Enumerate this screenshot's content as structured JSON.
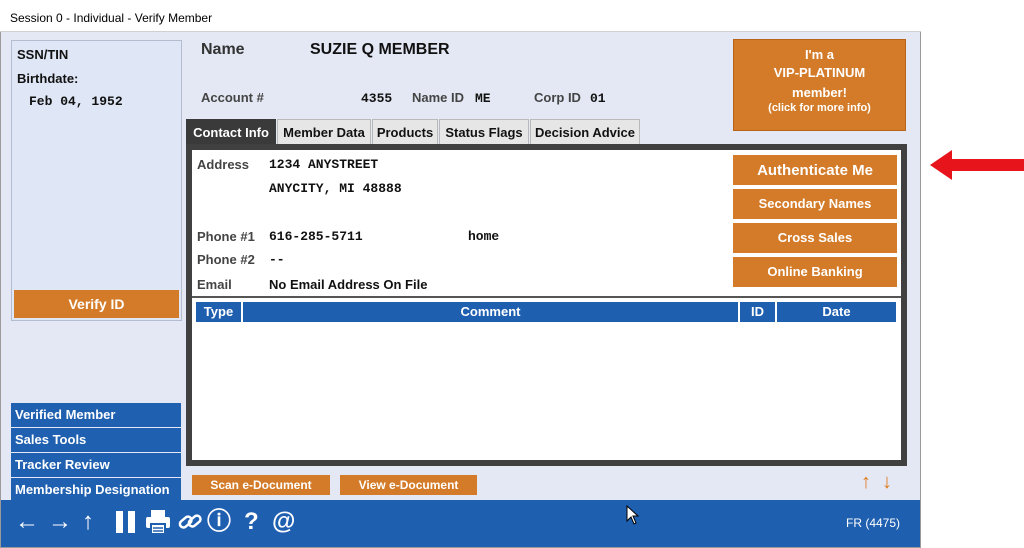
{
  "window": {
    "title": "Session 0  - Individual - Verify Member"
  },
  "left_panel": {
    "ssn_label": "SSN/TIN",
    "birthdate_label": "Birthdate:",
    "birthdate_value": "Feb 04, 1952",
    "verify_button": "Verify ID"
  },
  "nav": [
    {
      "label": "Verified Member"
    },
    {
      "label": "Sales Tools"
    },
    {
      "label": "Tracker Review"
    },
    {
      "label": "Membership Designation"
    }
  ],
  "header": {
    "name_label": "Name",
    "name_value": "SUZIE Q MEMBER",
    "account_label": "Account #",
    "account_value": "4355",
    "nameid_label": "Name ID",
    "nameid_value": "ME",
    "corpid_label": "Corp ID",
    "corpid_value": "01"
  },
  "vip": {
    "line1": "I'm a",
    "line2": "VIP-PLATINUM",
    "line3": "member!",
    "line4": "(click for more info)"
  },
  "tabs": [
    {
      "label": "Contact Info"
    },
    {
      "label": "Member Data"
    },
    {
      "label": "Products"
    },
    {
      "label": "Status Flags"
    },
    {
      "label": "Decision Advice"
    }
  ],
  "contact": {
    "address_label": "Address",
    "address_line1": "1234 ANYSTREET",
    "address_line2": "ANYCITY, MI  48888",
    "phone1_label": "Phone #1",
    "phone1_value": "616-285-5711",
    "phone1_type": "home",
    "phone2_label": "Phone #2",
    "phone2_value": "--",
    "email_label": "Email",
    "email_value": "No Email Address On File"
  },
  "side_buttons": {
    "authenticate": "Authenticate Me",
    "secondary": "Secondary Names",
    "cross_sales": "Cross Sales",
    "online_banking": "Online Banking"
  },
  "table": {
    "columns": [
      "Type",
      "Comment",
      "ID",
      "Date"
    ]
  },
  "doc_buttons": {
    "scan": "Scan e-Document",
    "view": "View e-Document"
  },
  "toolbar": {
    "icons": [
      "back-arrow-icon",
      "forward-arrow-icon",
      "up-arrow-icon",
      "pause-icon",
      "print-icon",
      "link-icon",
      "info-icon",
      "help-icon",
      "at-icon"
    ],
    "glyphs": {
      "back": "←",
      "forward": "→",
      "up": "↑",
      "info": "ⓘ",
      "help": "?",
      "at": "@",
      "sort_up": "↑",
      "sort_down": "↓"
    },
    "status": "FR (4475)"
  },
  "colors": {
    "accent_orange": "#d37b28",
    "nav_blue": "#1f5fb0",
    "arrow_red": "#e8141c"
  }
}
